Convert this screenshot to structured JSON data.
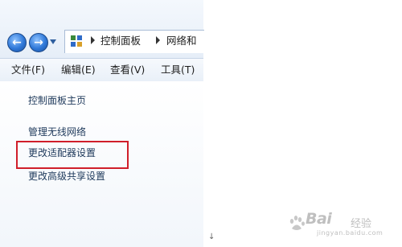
{
  "address": {
    "crumbs": [
      "控制面板",
      "网络和"
    ]
  },
  "menu": [
    "文件(F)",
    "编辑(E)",
    "查看(V)",
    "工具(T)"
  ],
  "tasks": [
    "控制面板主页",
    "管理无线网络",
    "更改适配器设置",
    "更改高级共享设置"
  ],
  "highlight_color": "#d01e2a",
  "watermark": {
    "logo": "Bai",
    "sub": "经验",
    "url": "jingyan.baidu.com"
  }
}
